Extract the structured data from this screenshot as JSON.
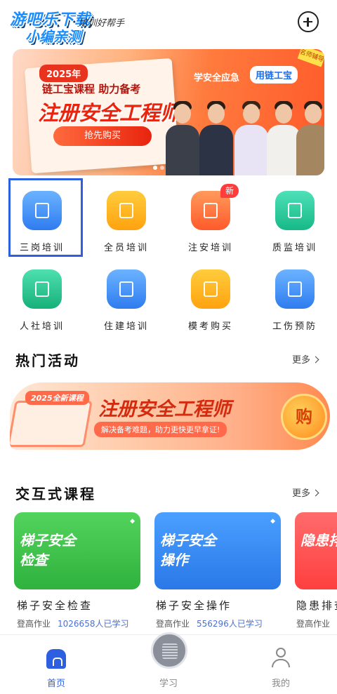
{
  "header": {
    "watermark_line1": "游吧乐下载",
    "watermark_line2": "小编亲测",
    "slogan": "培训好帮手",
    "add_icon": "plus-circle-icon"
  },
  "banner": {
    "year_tag": "2025年",
    "subtitle": "链工宝课程  助力备考",
    "title": "注册安全工程师",
    "buy_label": "抢先购买",
    "safety_text": "学安全应急",
    "safety_tag": "用链工宝",
    "corner_tag": "名师辅导",
    "active_slide": 1,
    "slide_count": 2
  },
  "grid": {
    "items": [
      {
        "label": "三岗培训",
        "icon": "document-icon",
        "color": "#3d8ef0"
      },
      {
        "label": "全员培训",
        "icon": "all-staff-icon",
        "color": "#ffb21c"
      },
      {
        "label": "注安培训",
        "icon": "safety-engineer-icon",
        "color": "#ff6a3a",
        "badge": "新"
      },
      {
        "label": "质监培训",
        "icon": "shield-check-icon",
        "color": "#1fc59a"
      },
      {
        "label": "人社培训",
        "icon": "person-icon",
        "color": "#1fbd8a"
      },
      {
        "label": "住建培训",
        "icon": "building-icon",
        "color": "#3d8ef0"
      },
      {
        "label": "模考购买",
        "icon": "shopping-bag-icon",
        "color": "#ffb21c"
      },
      {
        "label": "工伤预防",
        "icon": "work-injury-icon",
        "color": "#3d8ef0"
      }
    ]
  },
  "hot": {
    "title": "热门活动",
    "more": "更多",
    "promo_tag": "2025全新课程",
    "promo_title": "注册安全工程师",
    "promo_sub": "解决备考难题，助力更快更早拿证!",
    "promo_buy": "购"
  },
  "interactive": {
    "title": "交互式课程",
    "more": "更多",
    "cards": [
      {
        "title": "梯子安全\n检查",
        "name": "梯子安全检查",
        "meta": "登高作业",
        "count": "1026658人已学习",
        "color": "#3cc24a"
      },
      {
        "title": "梯子安全\n操作",
        "name": "梯子安全操作",
        "meta": "登高作业",
        "count": "556296人已学习",
        "color": "#2f86f0"
      },
      {
        "title": "隐患排",
        "name": "隐患排查",
        "meta": "登高作业",
        "count": "",
        "color": "#ff4a4a"
      }
    ]
  },
  "tabbar": {
    "tabs": [
      {
        "label": "首页",
        "active": true
      },
      {
        "label": "学习",
        "active": false
      },
      {
        "label": "我的",
        "active": false
      }
    ]
  }
}
